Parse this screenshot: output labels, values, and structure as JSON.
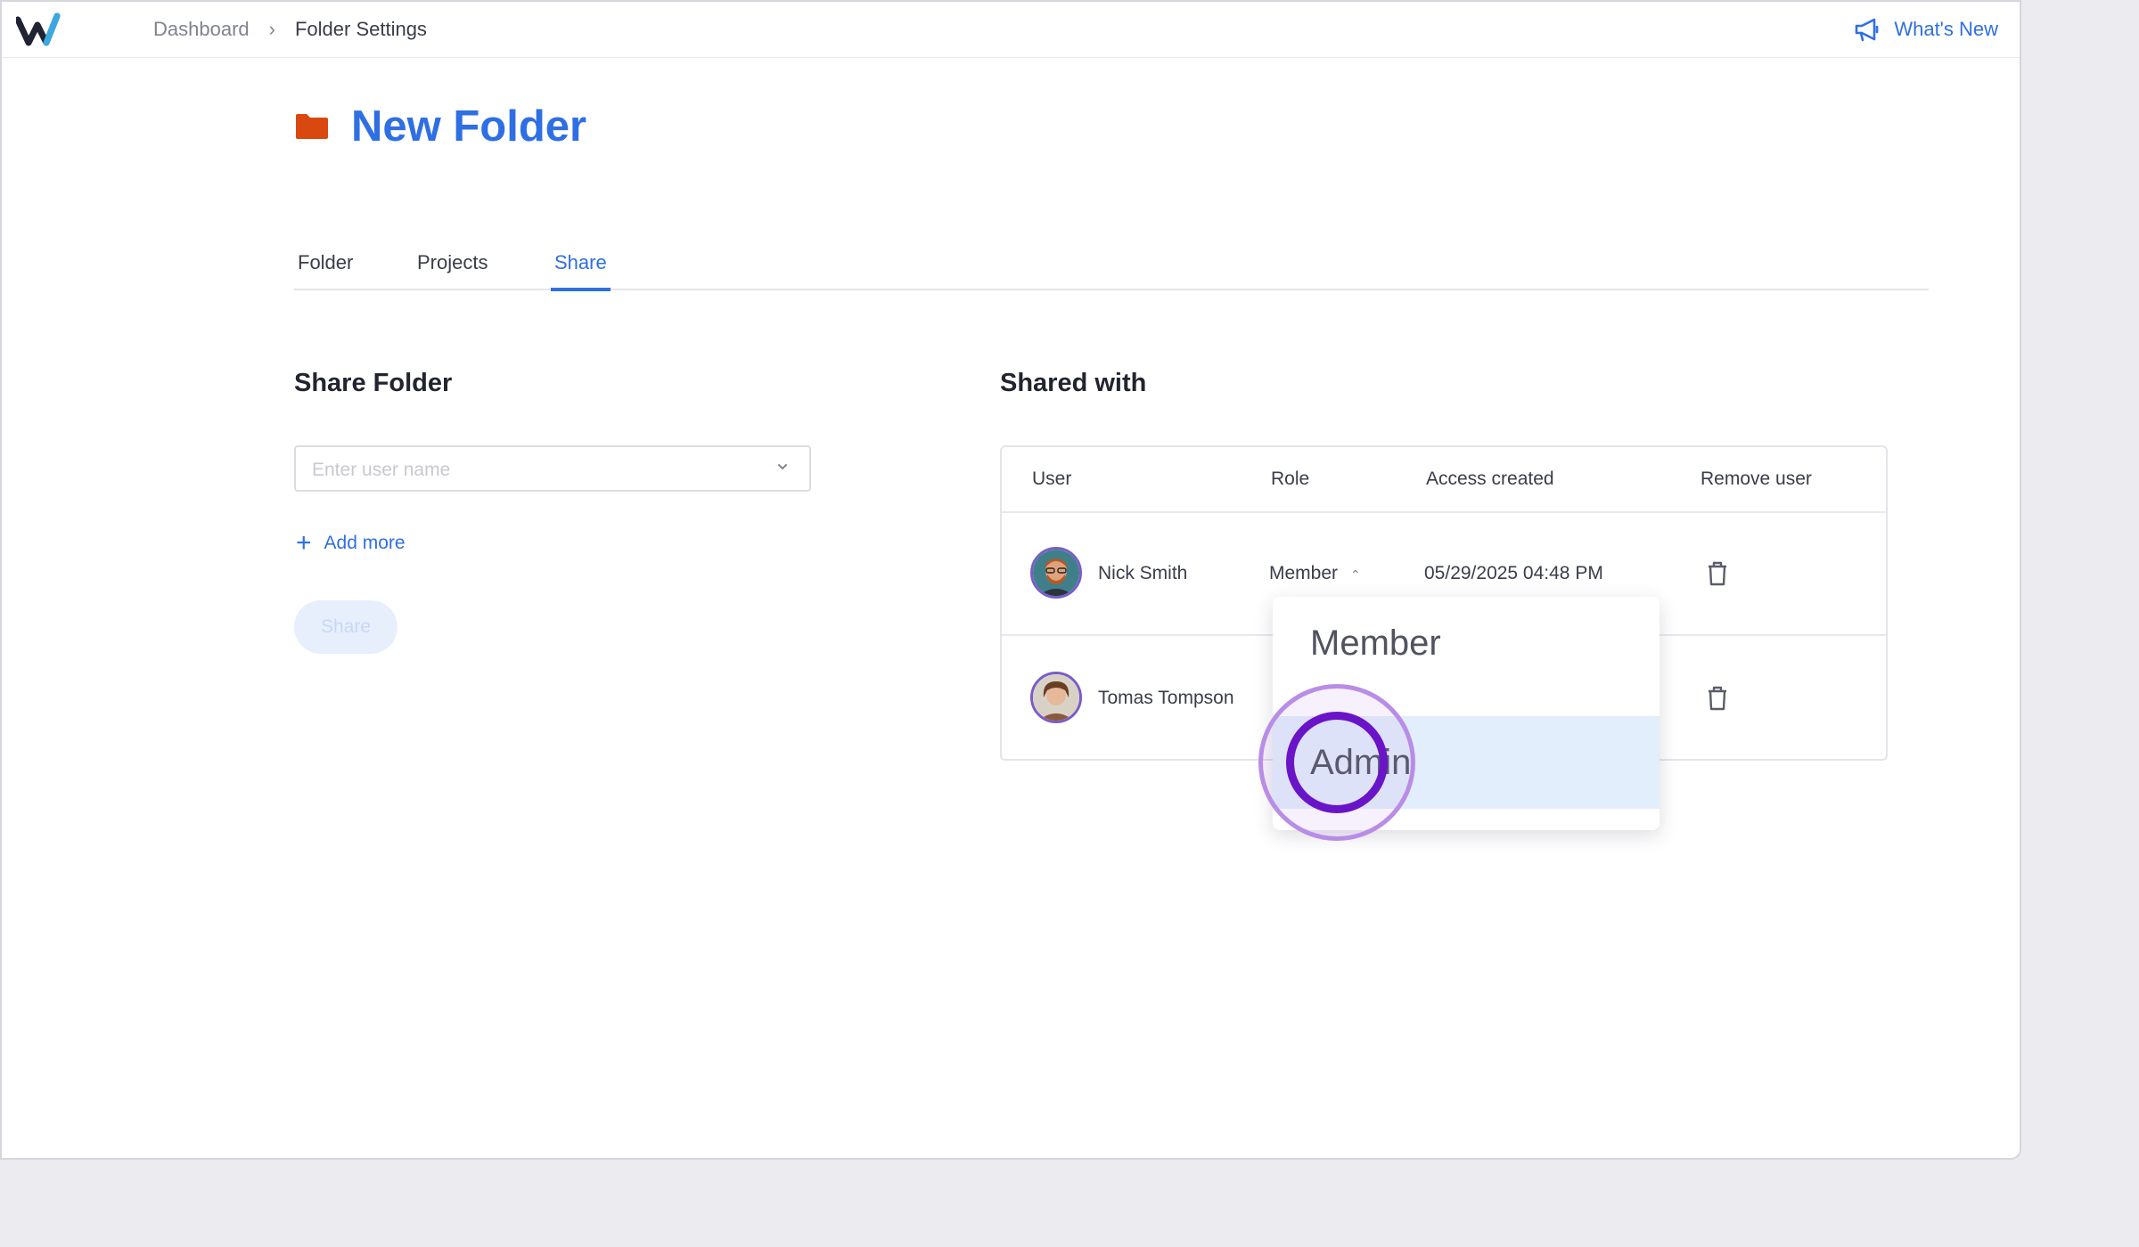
{
  "breadcrumb": {
    "parent": "Dashboard",
    "separator": "›",
    "current": "Folder Settings"
  },
  "header": {
    "whats_new": "What's New"
  },
  "page": {
    "title": "New Folder",
    "folder_icon_color": "#d9480f"
  },
  "tabs": [
    {
      "label": "Folder",
      "active": false
    },
    {
      "label": "Projects",
      "active": false
    },
    {
      "label": "Share",
      "active": true
    }
  ],
  "share_folder": {
    "title": "Share Folder",
    "input_placeholder": "Enter user name",
    "add_more": "Add more",
    "share_button": "Share"
  },
  "shared_with": {
    "title": "Shared with",
    "columns": [
      "User",
      "Role",
      "Access created",
      "Remove user"
    ],
    "rows": [
      {
        "user": "Nick Smith",
        "role": "Member",
        "access_created": "05/29/2025 04:48 PM"
      },
      {
        "user": "Tomas Tompson"
      }
    ]
  },
  "role_dropdown": {
    "options": [
      "Member",
      "Admin"
    ],
    "highlighted": "Admin"
  },
  "colors": {
    "accent": "#2f6fe4",
    "cursor": "#6a14c8"
  }
}
